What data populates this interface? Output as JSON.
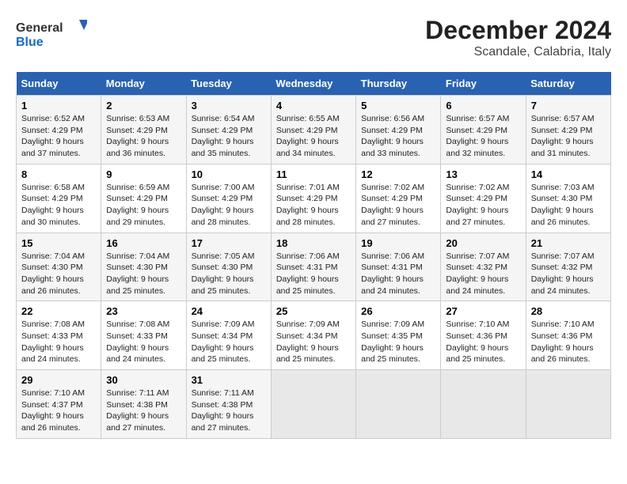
{
  "logo": {
    "general": "General",
    "blue": "Blue"
  },
  "title": "December 2024",
  "subtitle": "Scandale, Calabria, Italy",
  "weekdays": [
    "Sunday",
    "Monday",
    "Tuesday",
    "Wednesday",
    "Thursday",
    "Friday",
    "Saturday"
  ],
  "weeks": [
    [
      {
        "day": "1",
        "sunrise": "Sunrise: 6:52 AM",
        "sunset": "Sunset: 4:29 PM",
        "daylight": "Daylight: 9 hours and 37 minutes."
      },
      {
        "day": "2",
        "sunrise": "Sunrise: 6:53 AM",
        "sunset": "Sunset: 4:29 PM",
        "daylight": "Daylight: 9 hours and 36 minutes."
      },
      {
        "day": "3",
        "sunrise": "Sunrise: 6:54 AM",
        "sunset": "Sunset: 4:29 PM",
        "daylight": "Daylight: 9 hours and 35 minutes."
      },
      {
        "day": "4",
        "sunrise": "Sunrise: 6:55 AM",
        "sunset": "Sunset: 4:29 PM",
        "daylight": "Daylight: 9 hours and 34 minutes."
      },
      {
        "day": "5",
        "sunrise": "Sunrise: 6:56 AM",
        "sunset": "Sunset: 4:29 PM",
        "daylight": "Daylight: 9 hours and 33 minutes."
      },
      {
        "day": "6",
        "sunrise": "Sunrise: 6:57 AM",
        "sunset": "Sunset: 4:29 PM",
        "daylight": "Daylight: 9 hours and 32 minutes."
      },
      {
        "day": "7",
        "sunrise": "Sunrise: 6:57 AM",
        "sunset": "Sunset: 4:29 PM",
        "daylight": "Daylight: 9 hours and 31 minutes."
      }
    ],
    [
      {
        "day": "8",
        "sunrise": "Sunrise: 6:58 AM",
        "sunset": "Sunset: 4:29 PM",
        "daylight": "Daylight: 9 hours and 30 minutes."
      },
      {
        "day": "9",
        "sunrise": "Sunrise: 6:59 AM",
        "sunset": "Sunset: 4:29 PM",
        "daylight": "Daylight: 9 hours and 29 minutes."
      },
      {
        "day": "10",
        "sunrise": "Sunrise: 7:00 AM",
        "sunset": "Sunset: 4:29 PM",
        "daylight": "Daylight: 9 hours and 28 minutes."
      },
      {
        "day": "11",
        "sunrise": "Sunrise: 7:01 AM",
        "sunset": "Sunset: 4:29 PM",
        "daylight": "Daylight: 9 hours and 28 minutes."
      },
      {
        "day": "12",
        "sunrise": "Sunrise: 7:02 AM",
        "sunset": "Sunset: 4:29 PM",
        "daylight": "Daylight: 9 hours and 27 minutes."
      },
      {
        "day": "13",
        "sunrise": "Sunrise: 7:02 AM",
        "sunset": "Sunset: 4:29 PM",
        "daylight": "Daylight: 9 hours and 27 minutes."
      },
      {
        "day": "14",
        "sunrise": "Sunrise: 7:03 AM",
        "sunset": "Sunset: 4:30 PM",
        "daylight": "Daylight: 9 hours and 26 minutes."
      }
    ],
    [
      {
        "day": "15",
        "sunrise": "Sunrise: 7:04 AM",
        "sunset": "Sunset: 4:30 PM",
        "daylight": "Daylight: 9 hours and 26 minutes."
      },
      {
        "day": "16",
        "sunrise": "Sunrise: 7:04 AM",
        "sunset": "Sunset: 4:30 PM",
        "daylight": "Daylight: 9 hours and 25 minutes."
      },
      {
        "day": "17",
        "sunrise": "Sunrise: 7:05 AM",
        "sunset": "Sunset: 4:30 PM",
        "daylight": "Daylight: 9 hours and 25 minutes."
      },
      {
        "day": "18",
        "sunrise": "Sunrise: 7:06 AM",
        "sunset": "Sunset: 4:31 PM",
        "daylight": "Daylight: 9 hours and 25 minutes."
      },
      {
        "day": "19",
        "sunrise": "Sunrise: 7:06 AM",
        "sunset": "Sunset: 4:31 PM",
        "daylight": "Daylight: 9 hours and 24 minutes."
      },
      {
        "day": "20",
        "sunrise": "Sunrise: 7:07 AM",
        "sunset": "Sunset: 4:32 PM",
        "daylight": "Daylight: 9 hours and 24 minutes."
      },
      {
        "day": "21",
        "sunrise": "Sunrise: 7:07 AM",
        "sunset": "Sunset: 4:32 PM",
        "daylight": "Daylight: 9 hours and 24 minutes."
      }
    ],
    [
      {
        "day": "22",
        "sunrise": "Sunrise: 7:08 AM",
        "sunset": "Sunset: 4:33 PM",
        "daylight": "Daylight: 9 hours and 24 minutes."
      },
      {
        "day": "23",
        "sunrise": "Sunrise: 7:08 AM",
        "sunset": "Sunset: 4:33 PM",
        "daylight": "Daylight: 9 hours and 24 minutes."
      },
      {
        "day": "24",
        "sunrise": "Sunrise: 7:09 AM",
        "sunset": "Sunset: 4:34 PM",
        "daylight": "Daylight: 9 hours and 25 minutes."
      },
      {
        "day": "25",
        "sunrise": "Sunrise: 7:09 AM",
        "sunset": "Sunset: 4:34 PM",
        "daylight": "Daylight: 9 hours and 25 minutes."
      },
      {
        "day": "26",
        "sunrise": "Sunrise: 7:09 AM",
        "sunset": "Sunset: 4:35 PM",
        "daylight": "Daylight: 9 hours and 25 minutes."
      },
      {
        "day": "27",
        "sunrise": "Sunrise: 7:10 AM",
        "sunset": "Sunset: 4:36 PM",
        "daylight": "Daylight: 9 hours and 25 minutes."
      },
      {
        "day": "28",
        "sunrise": "Sunrise: 7:10 AM",
        "sunset": "Sunset: 4:36 PM",
        "daylight": "Daylight: 9 hours and 26 minutes."
      }
    ],
    [
      {
        "day": "29",
        "sunrise": "Sunrise: 7:10 AM",
        "sunset": "Sunset: 4:37 PM",
        "daylight": "Daylight: 9 hours and 26 minutes."
      },
      {
        "day": "30",
        "sunrise": "Sunrise: 7:11 AM",
        "sunset": "Sunset: 4:38 PM",
        "daylight": "Daylight: 9 hours and 27 minutes."
      },
      {
        "day": "31",
        "sunrise": "Sunrise: 7:11 AM",
        "sunset": "Sunset: 4:38 PM",
        "daylight": "Daylight: 9 hours and 27 minutes."
      },
      null,
      null,
      null,
      null
    ]
  ]
}
